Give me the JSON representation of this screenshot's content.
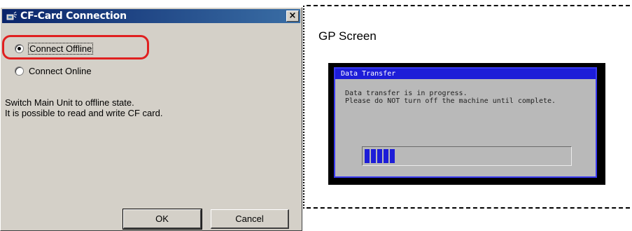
{
  "dialog": {
    "title": "CF-Card Connection",
    "close_label": "×",
    "options": [
      {
        "label": "Connect Offline",
        "selected": true
      },
      {
        "label": "Connect Online",
        "selected": false
      }
    ],
    "description": [
      "Switch Main Unit to offline state.",
      "It is possible to read and write CF card."
    ],
    "ok_label": "OK",
    "cancel_label": "Cancel"
  },
  "gp": {
    "label": "GP Screen",
    "window_title": "Data Transfer",
    "message_line1": "Data transfer is in progress.",
    "message_line2": "Please do NOT turn off the machine until complete.",
    "progress_fraction": 0.15
  },
  "colors": {
    "highlight": "#e02020",
    "gp_accent": "#1d1dd8"
  }
}
